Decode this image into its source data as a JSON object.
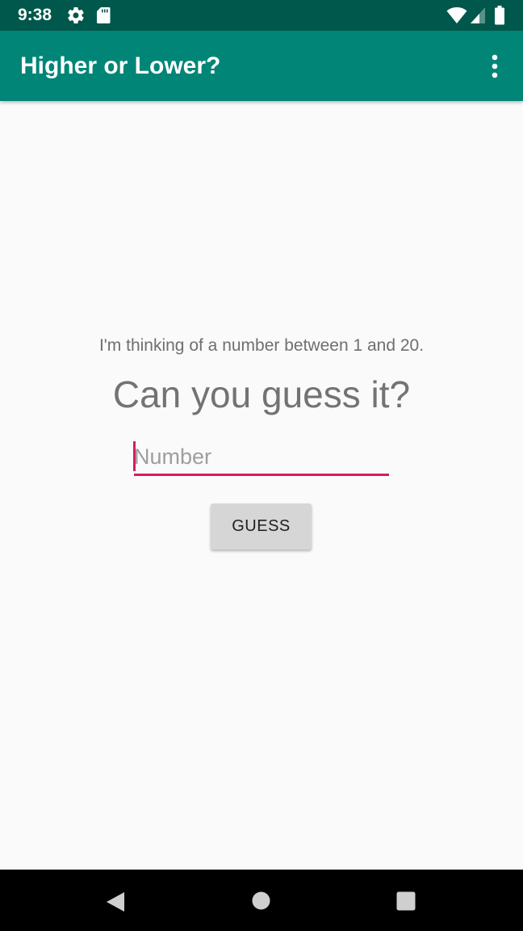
{
  "status_bar": {
    "time": "9:38",
    "icons": [
      "settings-gear-icon",
      "sd-card-icon",
      "wifi-icon",
      "cell-signal-icon",
      "battery-icon"
    ]
  },
  "app_bar": {
    "title": "Higher or Lower?",
    "overflow_icon": "more-vert-icon",
    "background_color": "#008577",
    "status_color": "#00574b"
  },
  "main": {
    "prompt": "I'm thinking of a number between 1 and 20.",
    "headline": "Can you guess it?",
    "number_input": {
      "value": "",
      "placeholder": "Number"
    },
    "guess_button_label": "GUESS",
    "accent_color": "#d81b60"
  },
  "nav_bar": {
    "icons": [
      "back-icon",
      "home-icon",
      "recents-icon"
    ]
  }
}
